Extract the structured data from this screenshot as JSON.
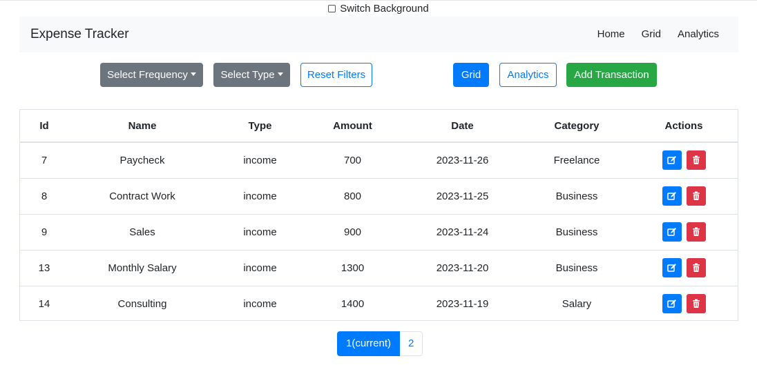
{
  "switch": {
    "label": "Switch Background",
    "checked": false
  },
  "navbar": {
    "brand": "Expense Tracker",
    "links": [
      "Home",
      "Grid",
      "Analytics"
    ]
  },
  "toolbar": {
    "frequency_label": "Select Frequency",
    "type_label": "Select Type",
    "reset_label": "Reset Filters",
    "grid_label": "Grid",
    "analytics_label": "Analytics",
    "add_label": "Add Transaction"
  },
  "table": {
    "headers": [
      "Id",
      "Name",
      "Type",
      "Amount",
      "Date",
      "Category",
      "Actions"
    ],
    "rows": [
      {
        "id": "7",
        "name": "Paycheck",
        "type": "income",
        "amount": "700",
        "date": "2023-11-26",
        "category": "Freelance"
      },
      {
        "id": "8",
        "name": "Contract Work",
        "type": "income",
        "amount": "800",
        "date": "2023-11-25",
        "category": "Business"
      },
      {
        "id": "9",
        "name": "Sales",
        "type": "income",
        "amount": "900",
        "date": "2023-11-24",
        "category": "Business"
      },
      {
        "id": "13",
        "name": "Monthly Salary",
        "type": "income",
        "amount": "1300",
        "date": "2023-11-20",
        "category": "Business"
      },
      {
        "id": "14",
        "name": "Consulting",
        "type": "income",
        "amount": "1400",
        "date": "2023-11-19",
        "category": "Salary"
      }
    ],
    "row_actions": {
      "edit_icon": "edit-icon",
      "delete_icon": "trash-icon"
    }
  },
  "pagination": {
    "current": "1(current)",
    "next": "2"
  },
  "colors": {
    "primary": "#007bff",
    "secondary": "#6c757d",
    "success": "#28a745",
    "danger": "#dc3545",
    "navbar_bg": "#f8f9fa"
  }
}
